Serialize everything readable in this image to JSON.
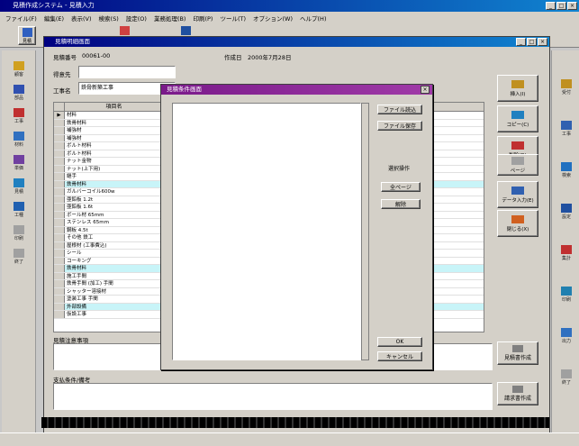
{
  "app": {
    "title": "見積作成システム - 見積入力"
  },
  "menu": [
    "ファイル(F)",
    "編集(E)",
    "表示(V)",
    "検索(S)",
    "設定(O)",
    "業務処理(B)",
    "印刷(P)",
    "ツール(T)",
    "オプション(W)",
    "ヘルプ(H)"
  ],
  "toolbar": {
    "first_label": "見積"
  },
  "left_side": [
    {
      "label": "顧客"
    },
    {
      "label": "部品"
    },
    {
      "label": "工事"
    },
    {
      "label": "材料"
    },
    {
      "label": "単価"
    },
    {
      "label": "見積"
    },
    {
      "label": "工種"
    },
    {
      "label": "印刷"
    },
    {
      "label": "終了"
    }
  ],
  "right_side": [
    {
      "label": "受付"
    },
    {
      "label": "工事"
    },
    {
      "label": "検索"
    },
    {
      "label": "設定"
    },
    {
      "label": "集計"
    },
    {
      "label": "印刷"
    },
    {
      "label": "出力"
    },
    {
      "label": "終了"
    }
  ],
  "child": {
    "title": "見積明細画面",
    "estimate_no_label": "見積番号",
    "estimate_no": "00061-00",
    "date_label": "作成日",
    "date_value": "2000年7月28日",
    "customer_label": "得意先",
    "customer_value": "",
    "project_label": "工事名",
    "project_value": "鉄骨新築工事",
    "grid_header": [
      "",
      "項目名",
      ""
    ],
    "rows": [
      {
        "mark": "▶",
        "name": "材料",
        "hl": false
      },
      {
        "mark": "",
        "name": "鉄骨材料",
        "hl": false
      },
      {
        "mark": "",
        "name": "補強材",
        "hl": false
      },
      {
        "mark": "",
        "name": "補強材",
        "hl": false
      },
      {
        "mark": "",
        "name": "ボルト材料",
        "hl": false
      },
      {
        "mark": "",
        "name": "ボルト材料",
        "hl": false
      },
      {
        "mark": "",
        "name": "ナット金物",
        "hl": false
      },
      {
        "mark": "",
        "name": "ナット(上下用)",
        "hl": false
      },
      {
        "mark": "",
        "name": "継手",
        "hl": false
      },
      {
        "mark": "",
        "name": "鉄骨材料",
        "hl": true
      },
      {
        "mark": "",
        "name": "ガルバーコイル600w",
        "hl": false
      },
      {
        "mark": "",
        "name": "亜鉛板 1.2t",
        "hl": false
      },
      {
        "mark": "",
        "name": "亜鉛板 1.6t",
        "hl": false
      },
      {
        "mark": "",
        "name": "ボール材 65mm",
        "hl": false
      },
      {
        "mark": "",
        "name": "ステンレス 65mm",
        "hl": false
      },
      {
        "mark": "",
        "name": "鋼板 4.5t",
        "hl": false
      },
      {
        "mark": "",
        "name": "その他 鉄工",
        "hl": false
      },
      {
        "mark": "",
        "name": "屋根材 (工事費込)",
        "hl": false
      },
      {
        "mark": "",
        "name": "シール",
        "hl": false
      },
      {
        "mark": "",
        "name": "コーキング",
        "hl": false
      },
      {
        "mark": "",
        "name": "鉄骨材料",
        "hl": true
      },
      {
        "mark": "",
        "name": "施工手間",
        "hl": false
      },
      {
        "mark": "",
        "name": "鉄骨手間 (加工) 手間",
        "hl": false
      },
      {
        "mark": "",
        "name": "シャッター溶接材",
        "hl": false
      },
      {
        "mark": "",
        "name": "塗装工事 手間",
        "hl": false
      },
      {
        "mark": "",
        "name": "外部設備",
        "hl": true
      },
      {
        "mark": "",
        "name": "仮設工事",
        "hl": false
      }
    ],
    "right_buttons": [
      {
        "label": "挿入(I)"
      },
      {
        "label": "コピー(C)"
      },
      {
        "label": "削除(D)"
      },
      {
        "label": "ページ"
      },
      {
        "label": "データ入力(E)"
      },
      {
        "label": "閉じる(X)"
      }
    ],
    "remark1_label": "見積注意事項",
    "remark2_label": "支払条件/備考",
    "remark_btn1": "見積書作成",
    "remark_btn2": "請求書作成"
  },
  "dialog": {
    "title": "見積条件画面",
    "btn_file_read": "ファイル読込",
    "btn_file_save": "ファイル保存",
    "group_label": "選択操作",
    "btn_all": "全ページ",
    "btn_clear": "解除",
    "btn_ok": "OK",
    "btn_cancel": "キャンセル"
  }
}
